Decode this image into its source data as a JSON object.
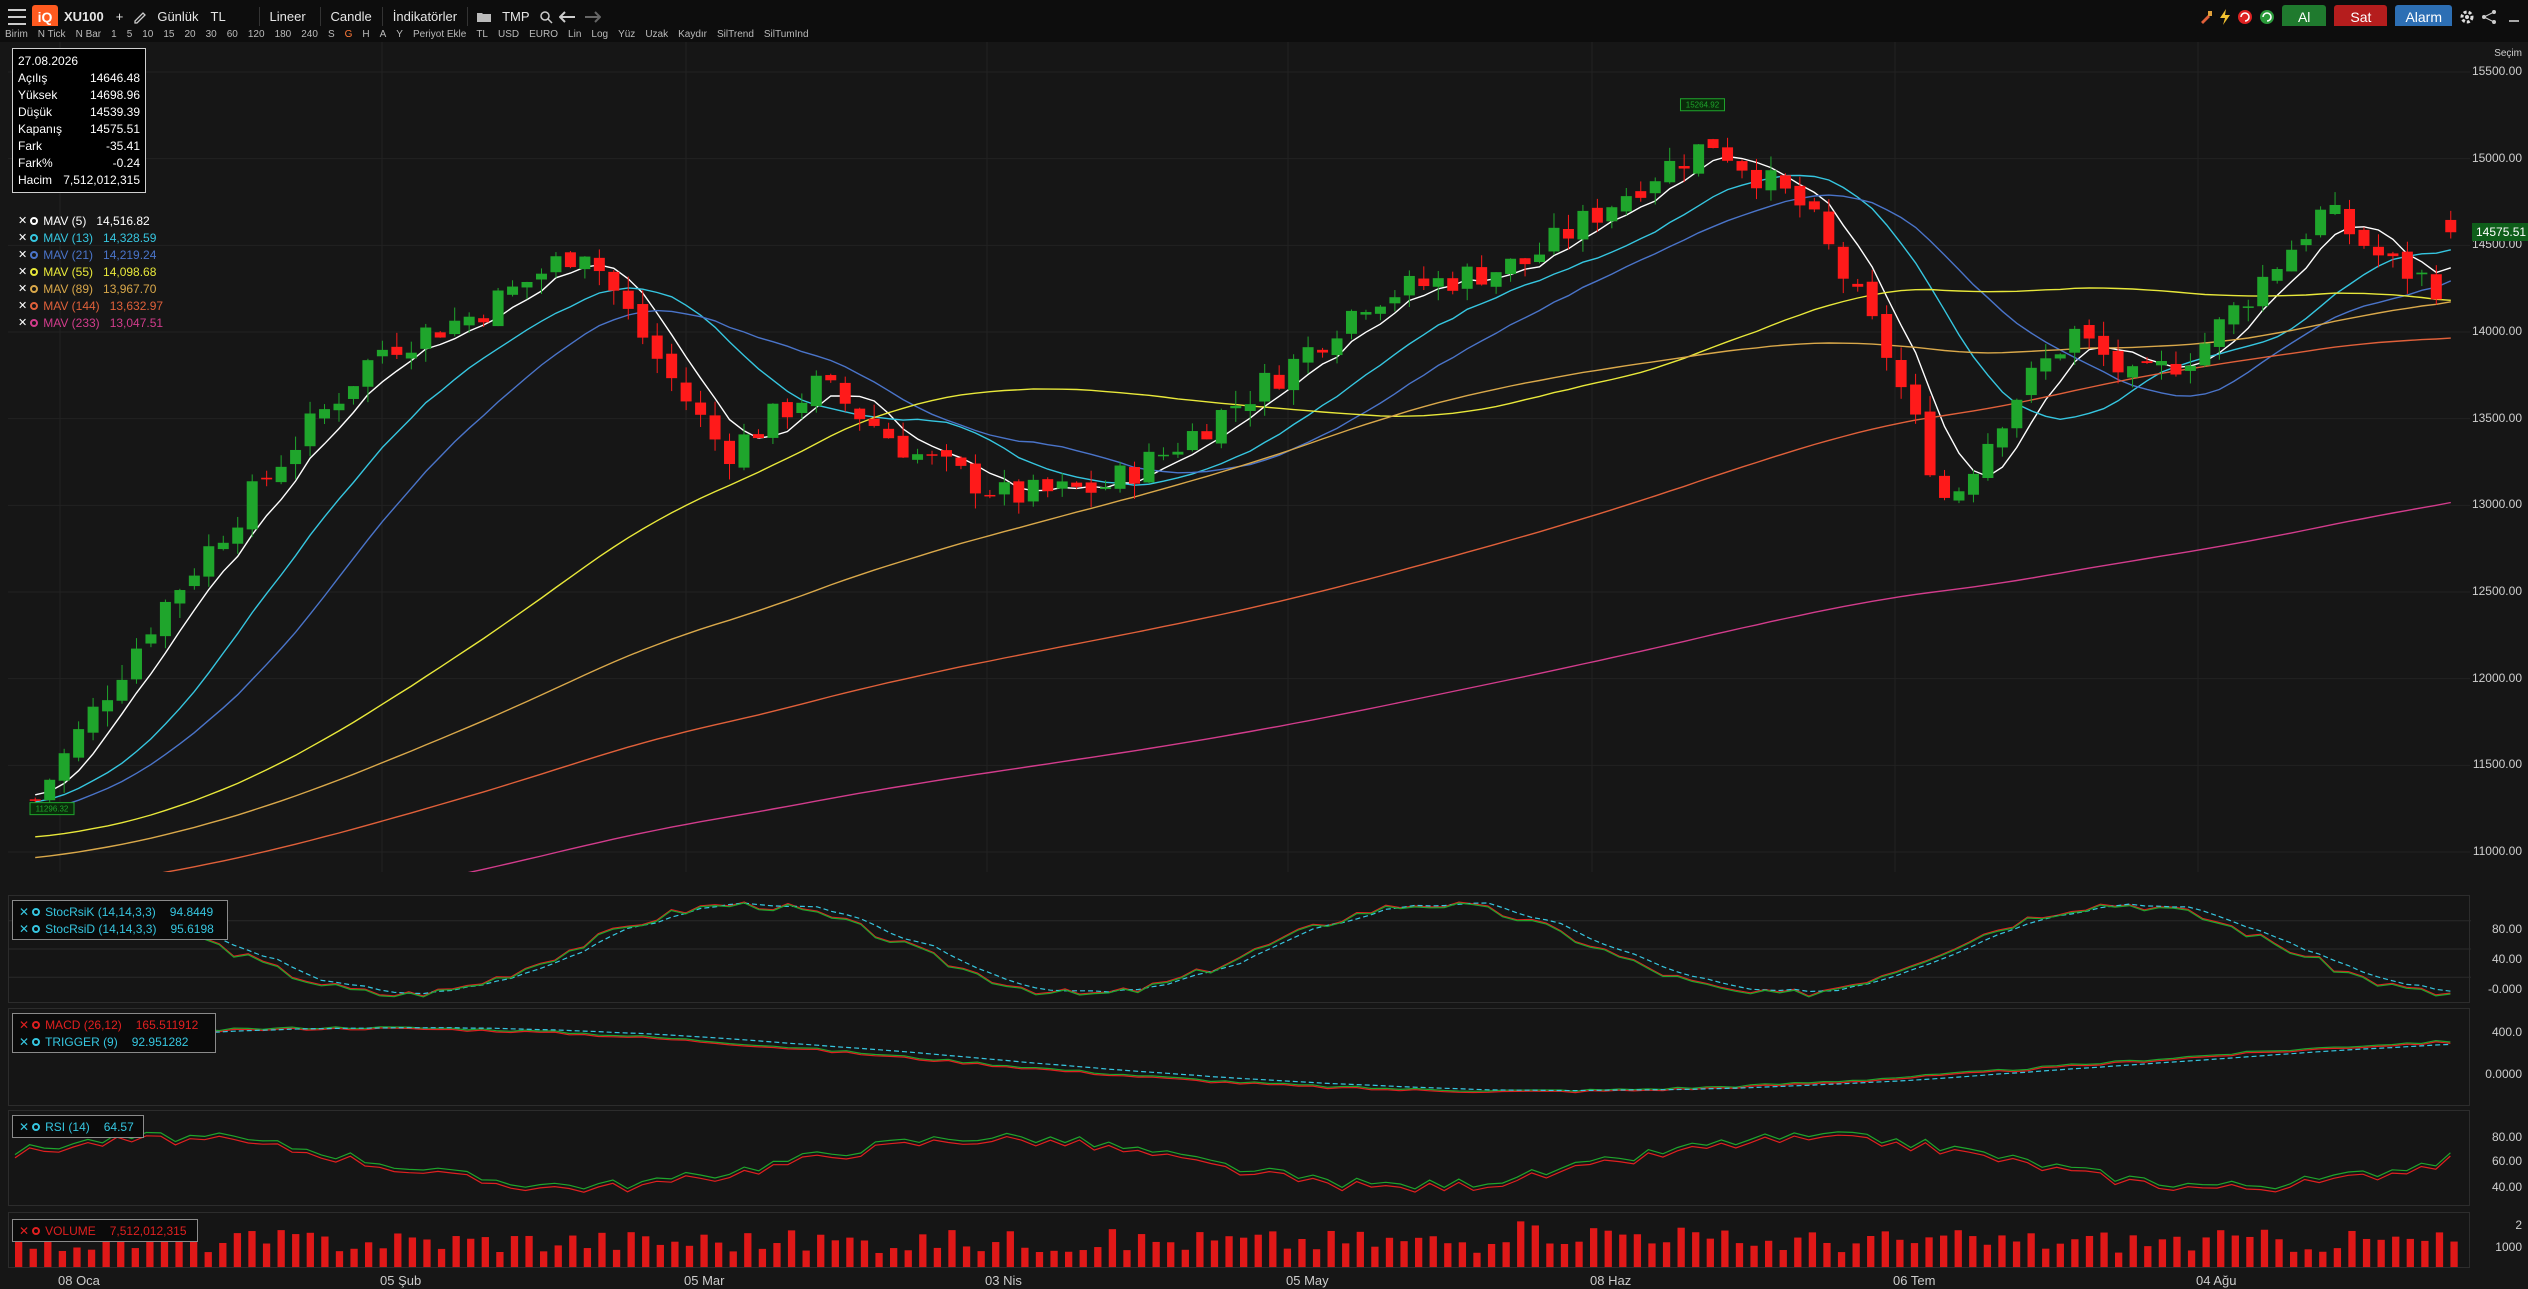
{
  "toolbar": {
    "symbol": "XU100",
    "add": "+",
    "period": "Günlük",
    "currency": "TL",
    "scale": "Lineer",
    "chart_type": "Candle",
    "indicators": "İndikatörler",
    "template": "TMP",
    "buy": "Al",
    "sell": "Sat",
    "alarm": "Alarm",
    "logo": "iQ"
  },
  "toolbar2": {
    "items": [
      "Birim",
      "N Tick",
      "N Bar",
      "1",
      "5",
      "10",
      "15",
      "20",
      "30",
      "60",
      "120",
      "180",
      "240",
      "S",
      "G",
      "H",
      "A",
      "Y",
      "Periyot Ekle",
      "TL",
      "USD",
      "EURO",
      "Lin",
      "Log",
      "Yüz",
      "Uzak",
      "Kaydır",
      "SilTrend",
      "SilTumInd"
    ],
    "active": "G"
  },
  "ohlc": {
    "date": "27.08.2026",
    "rows": [
      {
        "label": "Açılış",
        "value": "14646.48"
      },
      {
        "label": "Yüksek",
        "value": "14698.96"
      },
      {
        "label": "Düşük",
        "value": "14539.39"
      },
      {
        "label": "Kapanış",
        "value": "14575.51"
      },
      {
        "label": "Fark",
        "value": "-35.41"
      },
      {
        "label": "Fark%",
        "value": "-0.24"
      },
      {
        "label": "Hacim",
        "value": "7,512,012,315"
      }
    ]
  },
  "mav_legend": [
    {
      "name": "MAV (5)",
      "value": "14,516.82",
      "color": "#ffffff"
    },
    {
      "name": "MAV (13)",
      "value": "14,328.59",
      "color": "#36c6e0"
    },
    {
      "name": "MAV (21)",
      "value": "14,219.24",
      "color": "#4a74c9"
    },
    {
      "name": "MAV (55)",
      "value": "14,098.68",
      "color": "#e8e83a"
    },
    {
      "name": "MAV (89)",
      "value": "13,967.70",
      "color": "#d9a84a"
    },
    {
      "name": "MAV (144)",
      "value": "13,632.97",
      "color": "#e0603a"
    },
    {
      "name": "MAV (233)",
      "value": "13,047.51",
      "color": "#d23c8c"
    }
  ],
  "price_axis": {
    "ticks": [
      "15500.00",
      "15000.00",
      "14500.00",
      "14000.00",
      "13500.00",
      "13000.00",
      "12500.00",
      "12000.00",
      "11500.00",
      "11000.00"
    ],
    "last": "14575.51",
    "top_label": "Seçim"
  },
  "markers": {
    "high": "15264.92",
    "low": "11296.32"
  },
  "stoch": {
    "k_name": "StocRsiK (14,14,3,3)",
    "k_value": "94.8449",
    "d_name": "StocRsiD (14,14,3,3)",
    "d_value": "95.6198",
    "ticks": [
      "80.00",
      "40.00",
      "-0.000"
    ]
  },
  "macd": {
    "macd_name": "MACD (26,12)",
    "macd_value": "165.511912",
    "trig_name": "TRIGGER (9)",
    "trig_value": "92.951282",
    "ticks": [
      "400.0",
      "0.0000"
    ]
  },
  "rsi": {
    "name": "RSI (14)",
    "value": "64.57",
    "ticks": [
      "80.00",
      "60.00",
      "40.00"
    ]
  },
  "volume": {
    "name": "VOLUME",
    "value": "7,512,012,315",
    "ticks": [
      "2",
      "1000"
    ]
  },
  "x_axis": [
    "08 Oca",
    "05 Şub",
    "05 Mar",
    "03 Nis",
    "05 May",
    "08 Haz",
    "06 Tem",
    "04 Ağu"
  ],
  "colors": {
    "up": "#1fa52c",
    "down": "#ff1a1a",
    "background": "#161616"
  },
  "chart_data": {
    "type": "candlestick",
    "series_names": [
      "MAV (5)",
      "MAV (13)",
      "MAV (21)",
      "MAV (55)",
      "MAV (89)",
      "MAV (144)",
      "MAV (233)"
    ],
    "ylim": [
      11000,
      15500
    ],
    "last_close": 14575.51
  }
}
